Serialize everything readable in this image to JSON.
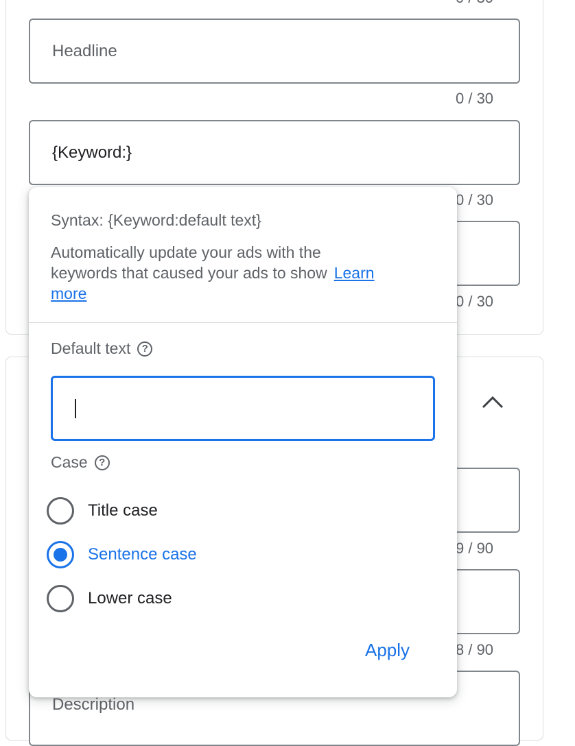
{
  "top_card": {
    "headline_fields": [
      {
        "placeholder": "Headline",
        "value": "",
        "counter": "0 / 30"
      },
      {
        "placeholder": "",
        "value": "{Keyword:}",
        "counter": "0 / 30"
      },
      {
        "placeholder": "",
        "value": "",
        "counter": "0 / 30"
      }
    ]
  },
  "bottom_card": {
    "description_fields": [
      {
        "counter": "9 / 90"
      },
      {
        "counter": "8 / 90"
      },
      {
        "placeholder": "Description"
      }
    ]
  },
  "popup": {
    "syntax": "Syntax: {Keyword:default text}",
    "description": "Automatically update your ads with the keywords that caused your ads to show",
    "learn_more": "Learn more",
    "default_text_label": "Default text",
    "default_text_value": "",
    "case_label": "Case",
    "case_options": [
      {
        "label": "Title case",
        "selected": false
      },
      {
        "label": "Sentence case",
        "selected": true
      },
      {
        "label": "Lower case",
        "selected": false
      }
    ],
    "apply_label": "Apply"
  },
  "colors": {
    "accent": "#1a73e8",
    "border": "#80868b",
    "text_secondary": "#5f6368"
  }
}
